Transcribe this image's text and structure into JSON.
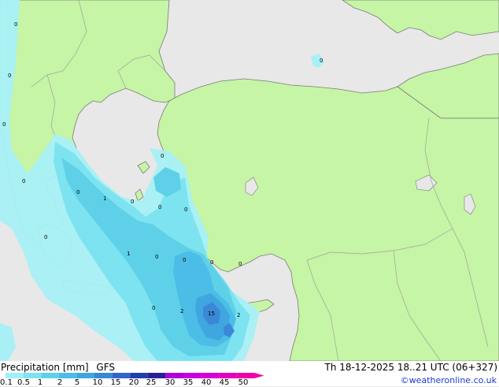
{
  "legend": {
    "title": "Precipitation [mm]",
    "model": "GFS",
    "scale_labels": [
      "0.1",
      "0.5",
      "1",
      "2",
      "5",
      "10",
      "15",
      "20",
      "25",
      "30",
      "35",
      "40",
      "45",
      "50"
    ],
    "scale_colors": [
      "#9ff0f8",
      "#7de3f0",
      "#5ed1e8",
      "#4cbde6",
      "#3fa6e0",
      "#3a88d6",
      "#2f66c8",
      "#1f3fae",
      "#2a1f9a",
      "#b000d8",
      "#c800e0",
      "#d800d8",
      "#e400c0",
      "#f000a8"
    ]
  },
  "datetime": "Th 18-12-2025 18..21 UTC (06+327)",
  "credit": "©weatheronline.co.uk",
  "map": {
    "colors": {
      "sea": "#e8e8e8",
      "land": "#c6f5a5",
      "border": "#a0a0a0",
      "coast": "#7a7a7a"
    },
    "point_values": [
      "0",
      "0",
      "0",
      "0",
      "1",
      "0",
      "0",
      "0",
      "1",
      "0",
      "0",
      "0",
      "0",
      "0",
      "2",
      "15",
      "2",
      "0"
    ]
  }
}
